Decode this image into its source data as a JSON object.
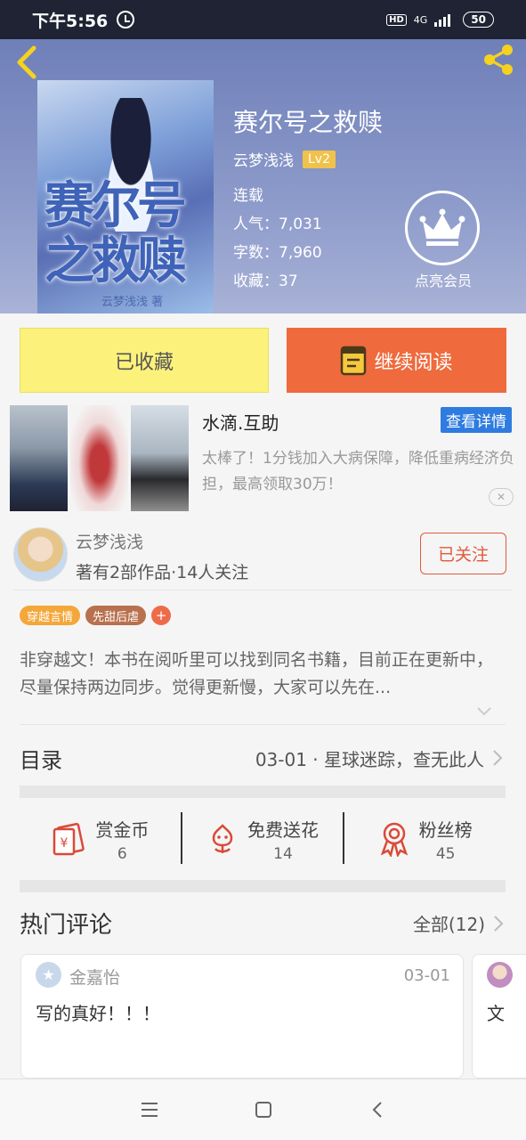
{
  "status_bar": {
    "time": "下午5:56",
    "hd": "HD",
    "network": "4G",
    "battery": "50"
  },
  "book": {
    "cover_title": "赛尔号之救赎",
    "cover_author": "云梦浅浅 著",
    "title": "赛尔号之救赎",
    "author": "云梦浅浅",
    "level": "Lv2",
    "status": "连载",
    "popularity": "人气：7,031",
    "word_count": "字数：7,960",
    "favorites": "收藏：37"
  },
  "vip": {
    "label": "点亮会员"
  },
  "actions": {
    "collected": "已收藏",
    "continue_read": "继续阅读"
  },
  "ad": {
    "title": "水滴.互助",
    "detail_button": "查看详情",
    "description": "太棒了！1分钱加入大病保障，降低重病经济负担，最高领取30万！",
    "close": "✕"
  },
  "author_card": {
    "name": "云梦浅浅",
    "stats": "著有2部作品·14人关注",
    "follow_button": "已关注"
  },
  "tags": [
    {
      "label": "穿越言情",
      "color": "#f4a73a"
    },
    {
      "label": "先甜后虐",
      "color": "#b8704e"
    }
  ],
  "tag_add": "+",
  "synopsis": "非穿越文！本书在阅听里可以找到同名书籍，目前正在更新中，尽量保持两边同步。觉得更新慢，大家可以先在...",
  "toc": {
    "label": "目录",
    "latest": "03-01 · 星球迷踪，查无此人"
  },
  "interactions": [
    {
      "label": "赏金币",
      "count": "6"
    },
    {
      "label": "免费送花",
      "count": "14"
    },
    {
      "label": "粉丝榜",
      "count": "45"
    }
  ],
  "comments_section": {
    "title": "热门评论",
    "all_label": "全部(12)"
  },
  "comments": [
    {
      "user": "金嘉怡",
      "date": "03-01",
      "text": "写的真好！！！"
    },
    {
      "text": "文"
    }
  ],
  "colors": {
    "accent": "#ef6a3c",
    "collected_bg": "#fcf27b",
    "header_bg": "#7f8ec4",
    "link_blue": "#2f7ce0"
  }
}
